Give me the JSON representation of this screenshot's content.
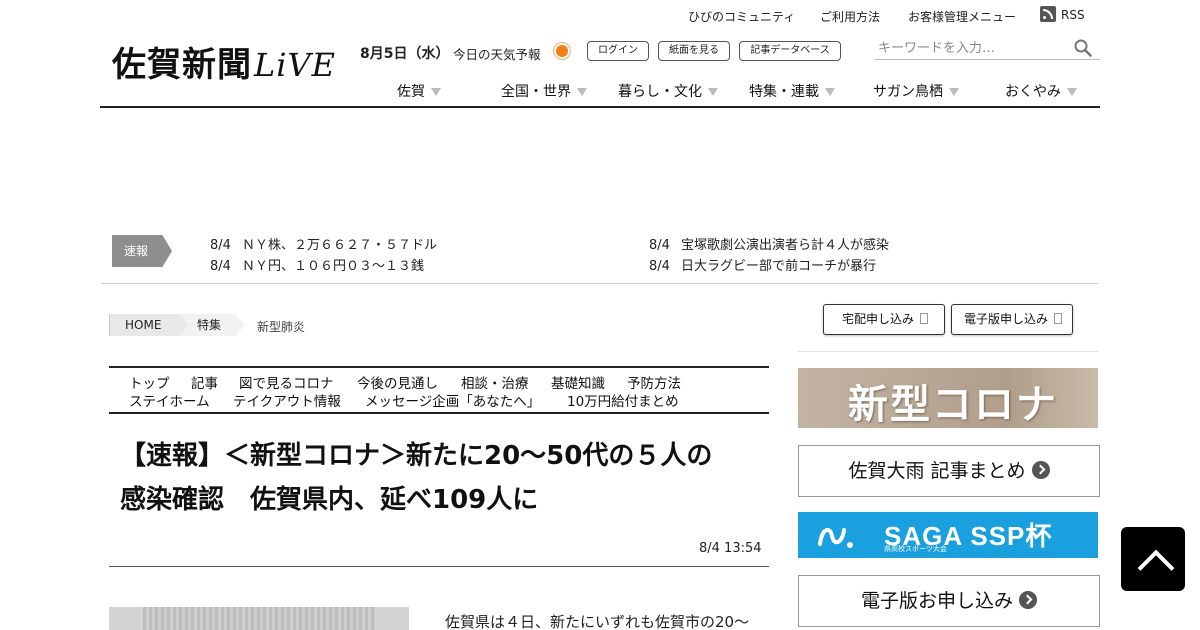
{
  "util_links": {
    "community": "ひびのコミュニティ",
    "usage": "ご利用方法",
    "account": "お客様管理メニュー",
    "rss": "RSS"
  },
  "logo": {
    "main": "佐賀新聞",
    "live": "LiVE"
  },
  "header": {
    "date": "8月5日（水）",
    "weather_label": "今日の天気予報",
    "weather_icon": "sun-icon",
    "login": "ログイン",
    "paper": "紙面を見る",
    "database": "記事データベース"
  },
  "search": {
    "placeholder": "キーワードを入力…"
  },
  "nav": {
    "items": [
      {
        "label": "佐賀"
      },
      {
        "label": "全国・世界"
      },
      {
        "label": "暮らし・文化"
      },
      {
        "label": "特集・連載"
      },
      {
        "label": "サガン鳥栖"
      },
      {
        "label": "おくやみ"
      }
    ]
  },
  "breaking": {
    "badge": "速報",
    "items": [
      {
        "date": "8/4",
        "text": "ＮＹ株、２万６６２７・５７ドル"
      },
      {
        "date": "8/4",
        "text": "ＮＹ円、１０６円０３～１３銭"
      },
      {
        "date": "8/4",
        "text": "宝塚歌劇公演出演者ら計４人が感染"
      },
      {
        "date": "8/4",
        "text": "日大ラグビー部で前コーチが暴行"
      }
    ]
  },
  "breadcrumb": {
    "home": "HOME",
    "category": "特集",
    "current": "新型肺炎"
  },
  "subnav": {
    "row1": [
      "トップ",
      "記事",
      "図で見るコロナ",
      "今後の見通し",
      "相談・治療",
      "基礎知識",
      "予防方法"
    ],
    "row2": [
      "ステイホーム",
      "テイクアウト情報",
      "メッセージ企画「あなたへ」",
      "10万円給付まとめ"
    ]
  },
  "article": {
    "title_line1": "【速報】＜新型コロナ＞新たに20～50代の５人の",
    "title_line2": "感染確認　佐賀県内、延べ109人に",
    "timestamp": "8/4 13:54",
    "body_start": "佐賀県は４日、新たにいずれも佐賀市の20～"
  },
  "sidebar": {
    "delivery": "宅配申し込み",
    "digital": "電子版申し込み",
    "covid_banner": "新型コロナ",
    "rain_summary": "佐賀大雨 記事まとめ",
    "ssp_main": "SAGA SSP杯",
    "ssp_sub": "県高校スポーツ大会",
    "digital_apply": "電子版お申し込み"
  },
  "colors": {
    "ssp_blue": "#1aa0de",
    "breaking_gray": "#8e8e8e",
    "weather_orange": "#f47f18"
  }
}
